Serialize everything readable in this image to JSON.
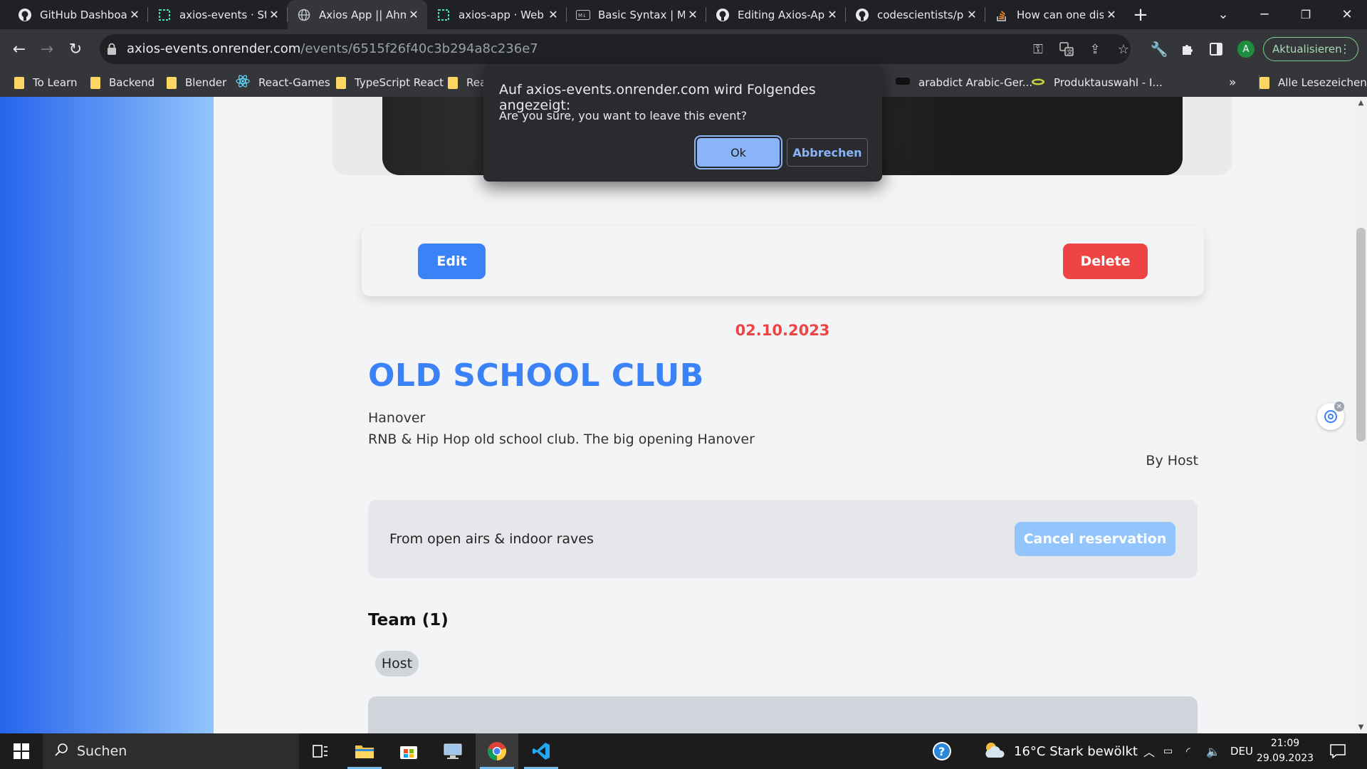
{
  "browser": {
    "tabs": [
      {
        "title": "GitHub Dashboard",
        "icon": "github-icon",
        "active": false
      },
      {
        "title": "axios-events · Static",
        "icon": "render-icon",
        "active": false
      },
      {
        "title": "Axios App || Ahmad",
        "icon": "globe-icon",
        "active": true
      },
      {
        "title": "axios-app · Web Service",
        "icon": "render-icon",
        "active": false
      },
      {
        "title": "Basic Syntax | Markdown",
        "icon": "markdown-icon",
        "active": false
      },
      {
        "title": "Editing Axios-App",
        "icon": "github-icon",
        "active": false
      },
      {
        "title": "codescientists/project",
        "icon": "github-icon",
        "active": false
      },
      {
        "title": "How can one disable",
        "icon": "stackoverflow-icon",
        "active": false
      }
    ],
    "new_tab_label": "+",
    "address": {
      "host": "axios-events.onrender.com",
      "path": "/events/6515f26f40c3b294a8c236e7"
    },
    "profile_initial": "A",
    "update_label": "Aktualisieren",
    "bookmarks": [
      {
        "label": "To Learn",
        "icon": "folder-icon"
      },
      {
        "label": "Backend",
        "icon": "folder-icon"
      },
      {
        "label": "Blender",
        "icon": "folder-icon"
      },
      {
        "label": "React-Games",
        "icon": "react-icon"
      },
      {
        "label": "TypeScript React",
        "icon": "folder-icon"
      },
      {
        "label": "Rea",
        "icon": "folder-icon"
      },
      {
        "label": "arabdict Arabic-Ger...",
        "icon": "arabdict-icon"
      },
      {
        "label": "Produktauswahl - I...",
        "icon": "product-icon"
      }
    ],
    "bookmarks_overflow": "»",
    "all_bookmarks_label": "Alle Lesezeichen"
  },
  "dialog": {
    "title": "Auf axios-events.onrender.com wird Folgendes angezeigt:",
    "message": "Are you sure, you want to leave this event?",
    "ok_label": "Ok",
    "cancel_label": "Abbrechen"
  },
  "event": {
    "edit_label": "Edit",
    "delete_label": "Delete",
    "date": "02.10.2023",
    "title": "OLD SCHOOL CLUB",
    "city": "Hanover",
    "description": "RNB & Hip Hop old school club. The big opening Hanover",
    "host_line": "By Host",
    "reservation_text": "From open airs & indoor raves",
    "cancel_reservation_label": "Cancel reservation",
    "team_heading": "Team (1)",
    "team_members": [
      "Host"
    ]
  },
  "taskbar": {
    "search_placeholder": "Suchen",
    "weather": "16°C  Stark bewölkt",
    "language": "DEU",
    "time": "21:09",
    "date": "29.09.2023"
  },
  "colors": {
    "primary": "#3b82f6",
    "danger": "#ef4444",
    "primary_light": "#93c5fd",
    "browser_dark": "#202124"
  }
}
